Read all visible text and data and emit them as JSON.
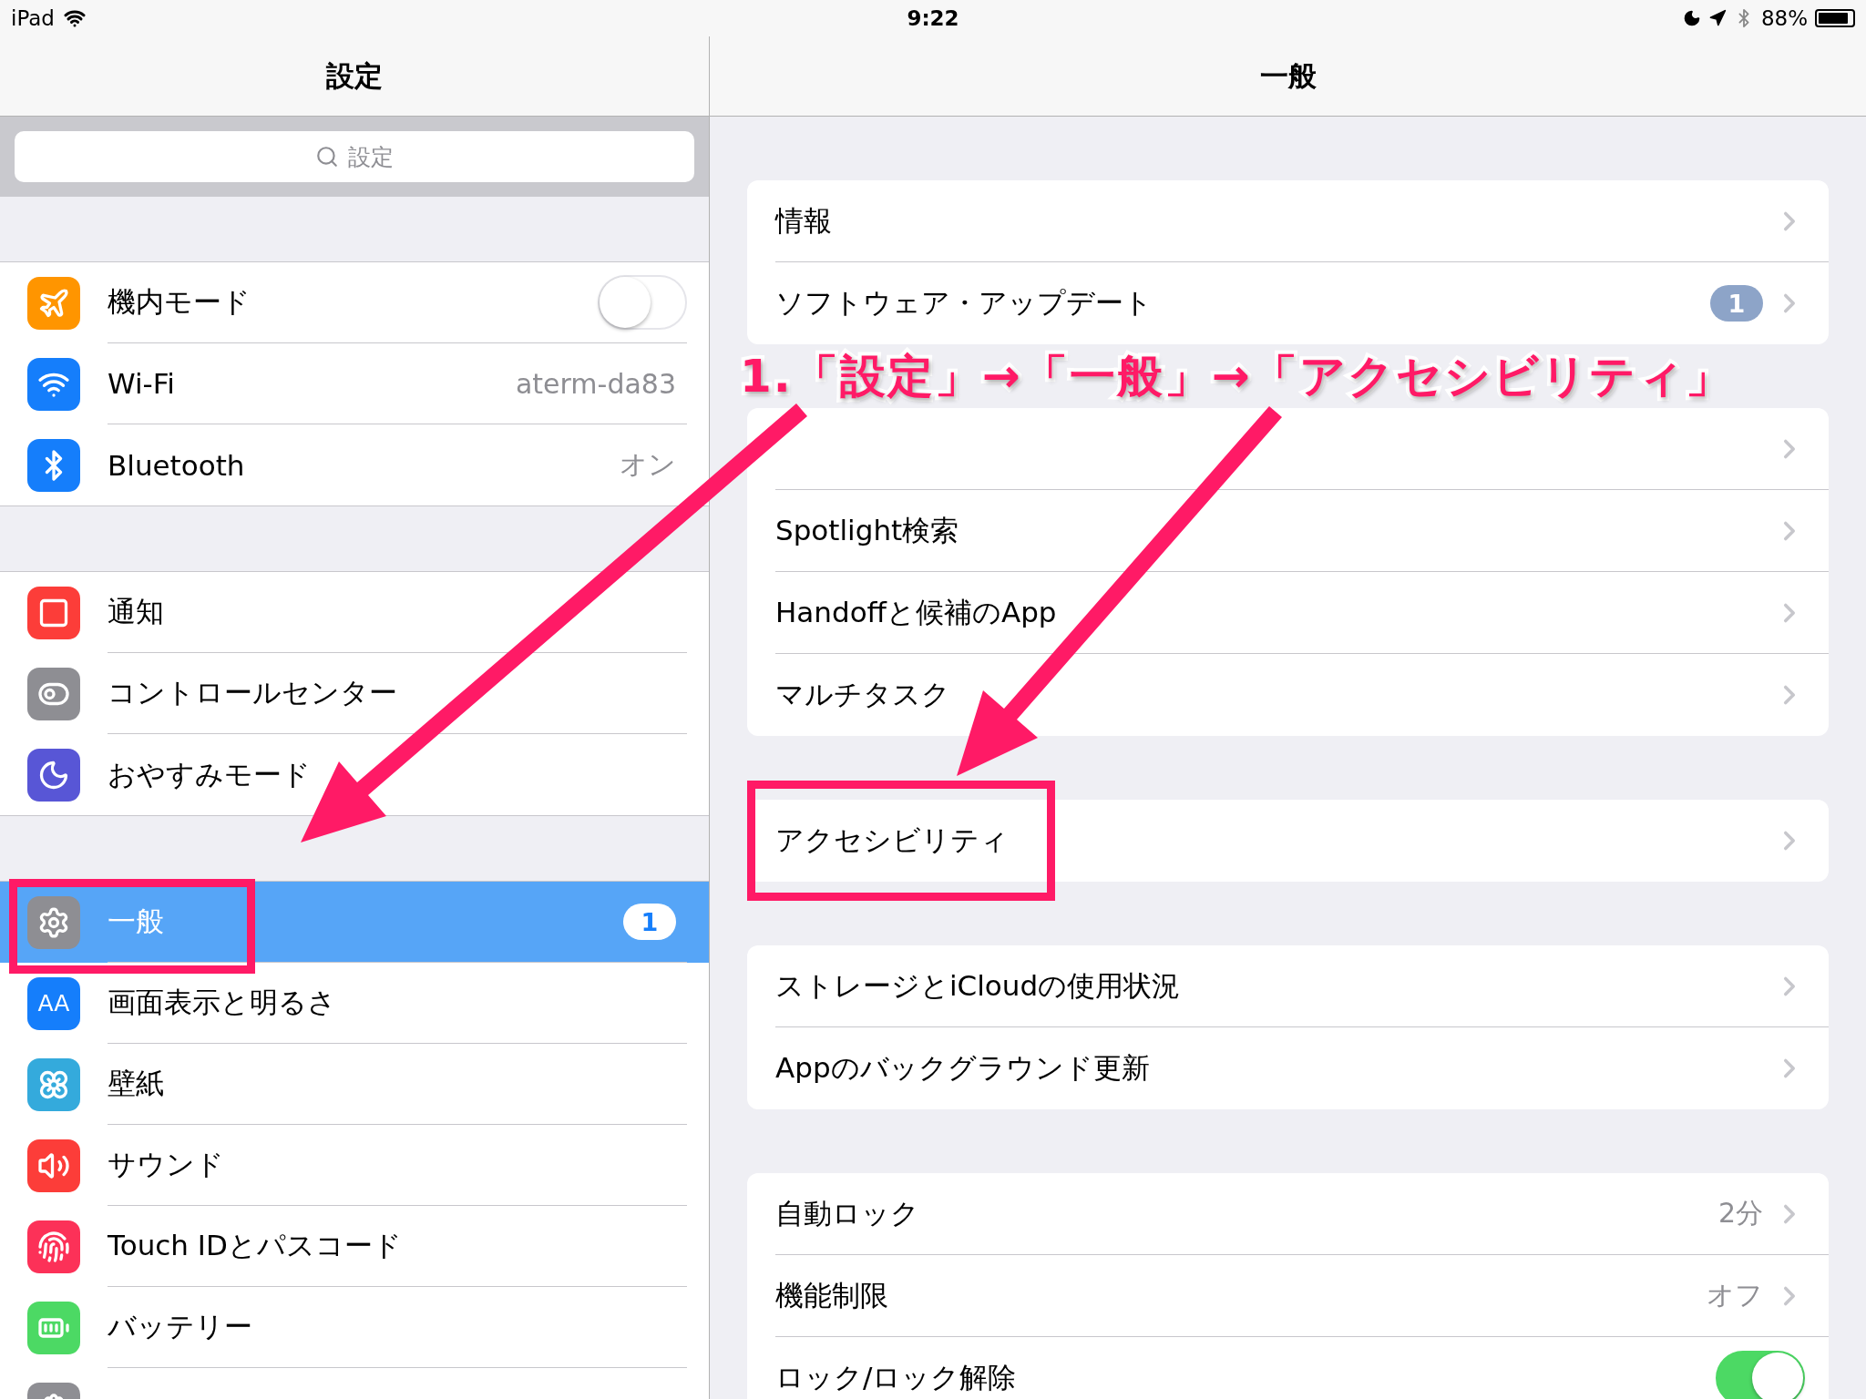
{
  "status_bar": {
    "device": "iPad",
    "time": "9:22",
    "battery": "88%"
  },
  "sidebar": {
    "title": "設定",
    "search": {
      "placeholder": "設定"
    },
    "groups": [
      [
        {
          "kind": "toggle",
          "label": "機内モード",
          "color": "#ff9500",
          "on": false,
          "selected": false
        },
        {
          "kind": "value",
          "label": "Wi-Fi",
          "color": "#157efb",
          "value": "aterm-da83",
          "selected": false
        },
        {
          "kind": "value",
          "label": "Bluetooth",
          "color": "#157efb",
          "value": "オン",
          "selected": false
        }
      ],
      [
        {
          "kind": "link",
          "label": "通知",
          "color": "#fc3d39",
          "selected": false
        },
        {
          "kind": "link",
          "label": "コントロールセンター",
          "color": "#8e8e93",
          "selected": false
        },
        {
          "kind": "link",
          "label": "おやすみモード",
          "color": "#5856d6",
          "selected": false
        }
      ],
      [
        {
          "kind": "link",
          "label": "一般",
          "color": "#8e8e93",
          "badge": "1",
          "selected": true
        },
        {
          "kind": "link",
          "label": "画面表示と明るさ",
          "color": "#157efb",
          "icon_text": "AA",
          "selected": false
        },
        {
          "kind": "link",
          "label": "壁紙",
          "color": "#34aadc",
          "selected": false
        },
        {
          "kind": "link",
          "label": "サウンド",
          "color": "#fc3d39",
          "selected": false
        },
        {
          "kind": "link",
          "label": "Touch IDとパスコード",
          "color": "#fc3158",
          "selected": false
        },
        {
          "kind": "link",
          "label": "バッテリー",
          "color": "#4cd964",
          "selected": false
        },
        {
          "kind": "link",
          "color": "#8e8e93",
          "selected": false
        }
      ]
    ]
  },
  "detail": {
    "title": "一般",
    "groups": [
      [
        {
          "kind": "link",
          "label": "情報"
        },
        {
          "kind": "link",
          "label": "ソフトウェア・アップデート",
          "badge": "1"
        }
      ],
      [
        {
          "kind": "link"
        },
        {
          "kind": "link",
          "label": "Spotlight検索"
        },
        {
          "kind": "link",
          "label": "Handoffと候補のApp"
        },
        {
          "kind": "link",
          "label": "マルチタスク"
        }
      ],
      [
        {
          "kind": "link",
          "label": "アクセシビリティ"
        }
      ],
      [
        {
          "kind": "link",
          "label": "ストレージとiCloudの使用状況"
        },
        {
          "kind": "link",
          "label": "Appのバックグラウンド更新"
        }
      ],
      [
        {
          "kind": "link",
          "label": "自動ロック",
          "value": "2分"
        },
        {
          "kind": "link",
          "label": "機能制限",
          "value": "オフ"
        },
        {
          "kind": "toggle",
          "label": "ロック/ロック解除",
          "on": true
        }
      ]
    ]
  },
  "annotation": {
    "caption": "1.「設定」→「一般」→「アクセシビリティ」"
  }
}
